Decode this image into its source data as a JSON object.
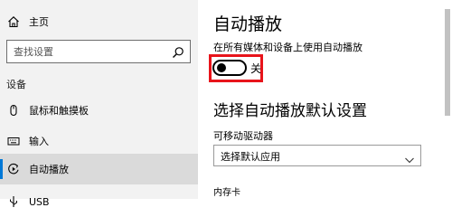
{
  "nav": {
    "home_label": "主页",
    "search_placeholder": "查找设置",
    "section_title": "设备",
    "items": [
      {
        "label": "鼠标和触摸板",
        "icon": "mouse-icon"
      },
      {
        "label": "输入",
        "icon": "keyboard-icon"
      },
      {
        "label": "自动播放",
        "icon": "autoplay-icon",
        "selected": true
      },
      {
        "label": "USB",
        "icon": "usb-icon"
      }
    ]
  },
  "main": {
    "title": "自动播放",
    "toggle_description": "在所有媒体和设备上使用自动播放",
    "toggle_state_label": "关",
    "toggle_on": false,
    "section_title": "选择自动播放默认设置",
    "removable_drive_label": "可移动驱动器",
    "removable_drive_value": "选择默认应用",
    "memory_card_label": "内存卡"
  },
  "colors": {
    "accent": "#0078d7",
    "highlight_box": "#e8141b",
    "nav_background": "#f2f2f2",
    "nav_selected_background": "#dadada"
  }
}
